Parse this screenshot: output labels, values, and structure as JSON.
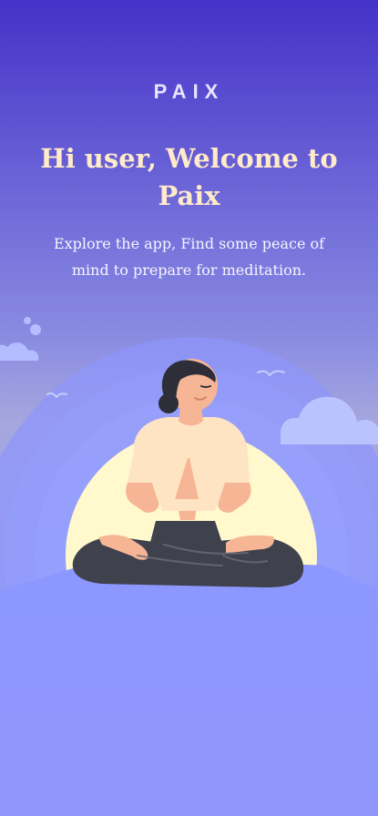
{
  "app": {
    "brand": "PAIX",
    "title": "Hi user, Welcome to Paix",
    "subtitle": "Explore the app, Find some peace of mind to prepare for meditation."
  },
  "illustration": {
    "subject": "meditating person on hill with sun",
    "icons": [
      "cloud-icon",
      "bird-icon"
    ]
  }
}
